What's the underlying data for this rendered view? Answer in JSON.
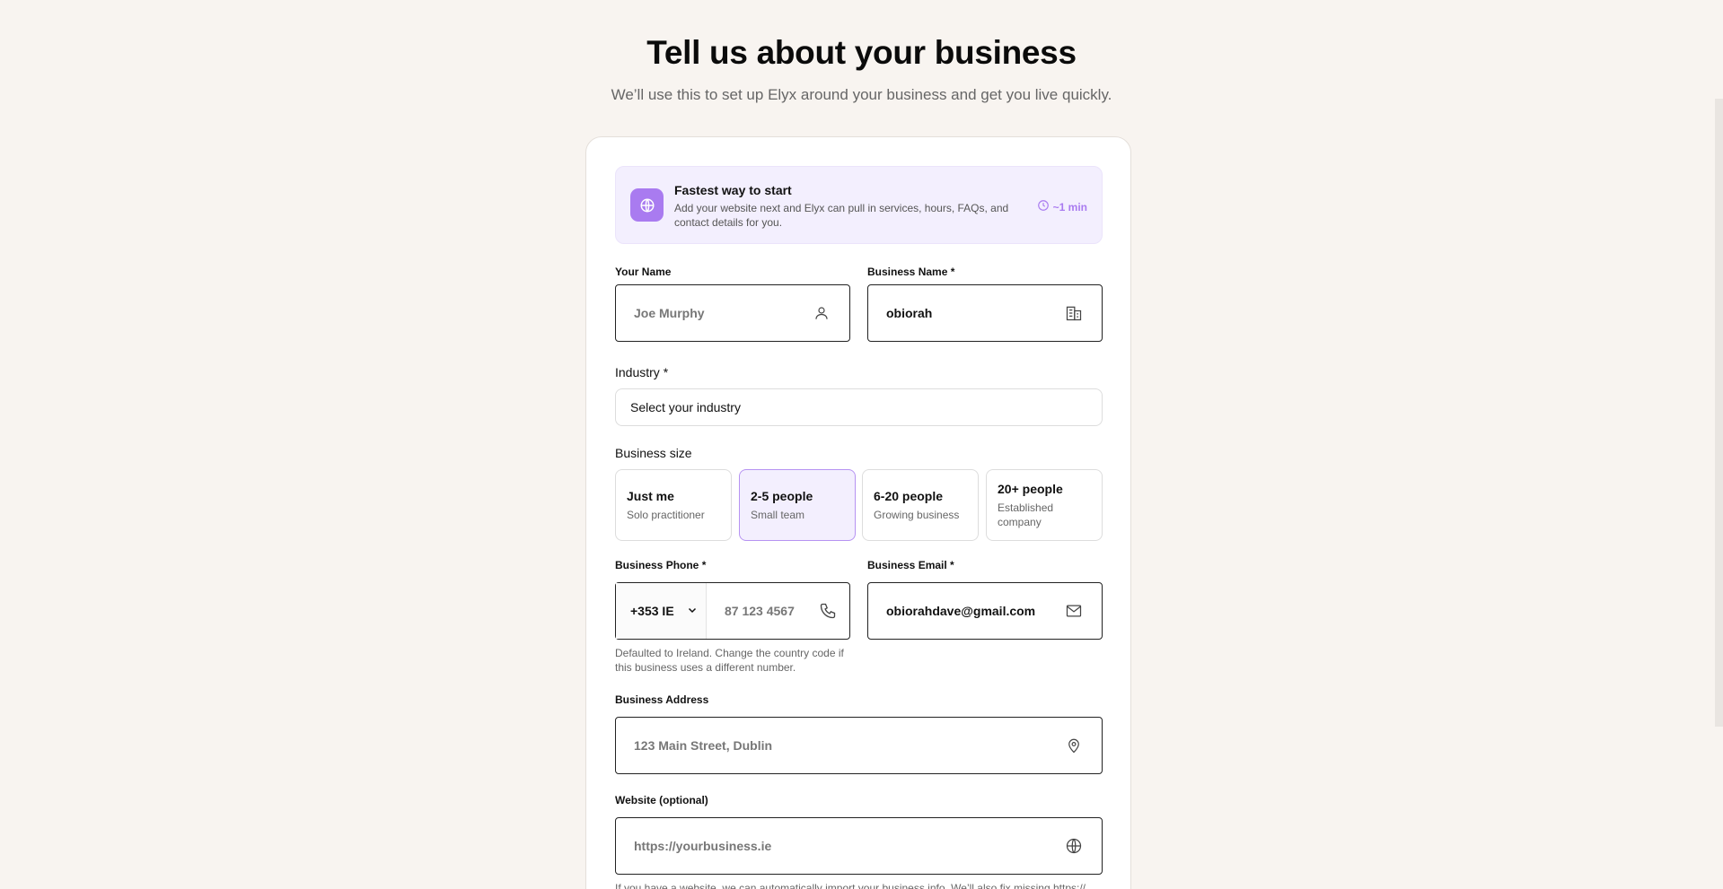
{
  "header": {
    "title": "Tell us about your business",
    "subtitle": "We’ll use this to set up Elyx around your business and get you live quickly."
  },
  "banner": {
    "title": "Fastest way to start",
    "description": "Add your website next and Elyx can pull in services, hours, FAQs, and contact details for you.",
    "time": "~1 min",
    "icon": "globe-icon",
    "accent_color": "#a97bf0"
  },
  "your_name": {
    "label": "Your Name",
    "placeholder": "Joe Murphy",
    "icon": "user-icon"
  },
  "business_name": {
    "label": "Business Name *",
    "value": "obiorah",
    "icon": "building-icon"
  },
  "industry": {
    "label": "Industry *",
    "selected": "Select your industry"
  },
  "business_size": {
    "label": "Business size",
    "options": [
      {
        "title": "Just me",
        "subtitle": "Solo practitioner",
        "selected": false
      },
      {
        "title": "2-5 people",
        "subtitle": "Small team",
        "selected": true
      },
      {
        "title": "6-20 people",
        "subtitle": "Growing business",
        "selected": false
      },
      {
        "title": "20+ people",
        "subtitle": "Established company",
        "selected": false
      }
    ]
  },
  "business_phone": {
    "label": "Business Phone *",
    "country_code": "+353 IE",
    "placeholder": "87 123 4567",
    "hint": "Defaulted to Ireland. Change the country code if this business uses a different number.",
    "icon": "phone-icon"
  },
  "business_email": {
    "label": "Business Email *",
    "value": "obiorahdave@gmail.com",
    "icon": "mail-icon"
  },
  "business_address": {
    "label": "Business Address",
    "placeholder": "123 Main Street, Dublin",
    "icon": "map-pin-icon"
  },
  "website": {
    "label": "Website (optional)",
    "placeholder": "https://yourbusiness.ie",
    "hint": "If you have a website, we can automatically import your business info. We’ll also fix missing https://",
    "icon": "globe-icon"
  }
}
